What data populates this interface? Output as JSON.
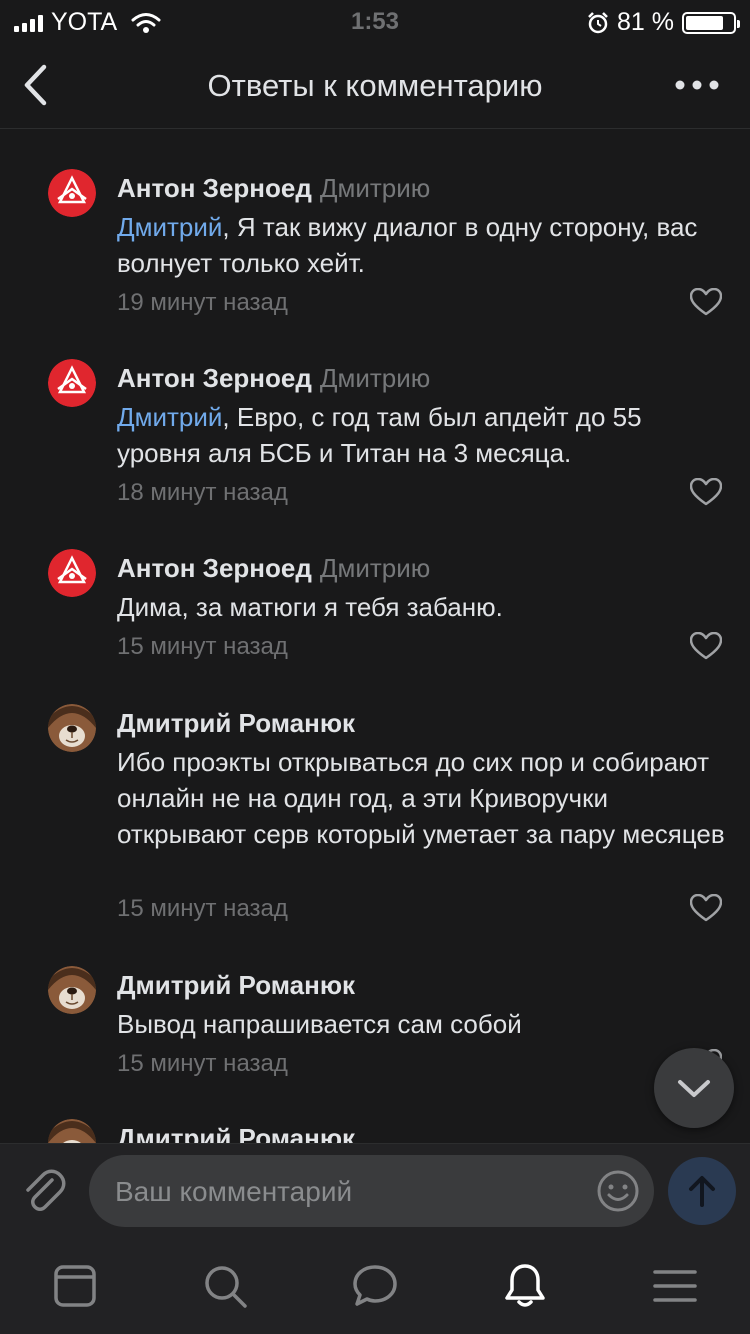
{
  "status_bar": {
    "carrier": "YOTA",
    "time": "1:53",
    "battery": "81 %"
  },
  "header": {
    "title": "Ответы к комментарию"
  },
  "comments": [
    {
      "author": "Антон Зерноед",
      "reply_to": "Дмитрию",
      "mention": "Дмитрий",
      "text": ", Я так вижу диалог в одну сторону, вас волнует только хейт.",
      "time": "19 минут назад"
    },
    {
      "author": "Антон Зерноед",
      "reply_to": "Дмитрию",
      "mention": "Дмитрий",
      "text": ", Евро, с год там был апдейт до 55 уровня аля БСБ и Титан на 3 месяца.",
      "time": "18 минут назад"
    },
    {
      "author": "Антон Зерноед",
      "reply_to": "Дмитрию",
      "mention": "",
      "text": "Дима, за матюги я тебя забаню.",
      "time": "15 минут назад"
    },
    {
      "author": "Дмитрий Романюк",
      "reply_to": "",
      "mention": "",
      "text": "Ибо проэкты открываться до сих пор и собирают онлайн не на один год, а эти Криворучки открывают серв который уметает за пару месяцев",
      "time": "15 минут назад"
    },
    {
      "author": "Дмитрий Романюк",
      "reply_to": "",
      "mention": "",
      "text": "Вывод напрашивается сам собой",
      "time": "15 минут назад"
    },
    {
      "author": "Дмитрий Романюк",
      "reply_to": "",
      "mention": "",
      "text": "",
      "time": ""
    }
  ],
  "input": {
    "placeholder": "Ваш комментарий"
  },
  "icons": {
    "back": "chevron-left-icon",
    "more": "more-horizontal-icon",
    "like": "heart-icon",
    "attach": "paperclip-icon",
    "emoji": "smile-icon",
    "send": "arrow-up-icon",
    "scroll": "chevron-down-icon",
    "tabs": [
      "newsfeed-icon",
      "search-icon",
      "messages-icon",
      "notifications-icon",
      "menu-icon"
    ]
  },
  "colors": {
    "background": "#19191a",
    "mention": "#71aaeb",
    "avatar_red": "#e0262e",
    "send_bg": "#2a3a52"
  }
}
